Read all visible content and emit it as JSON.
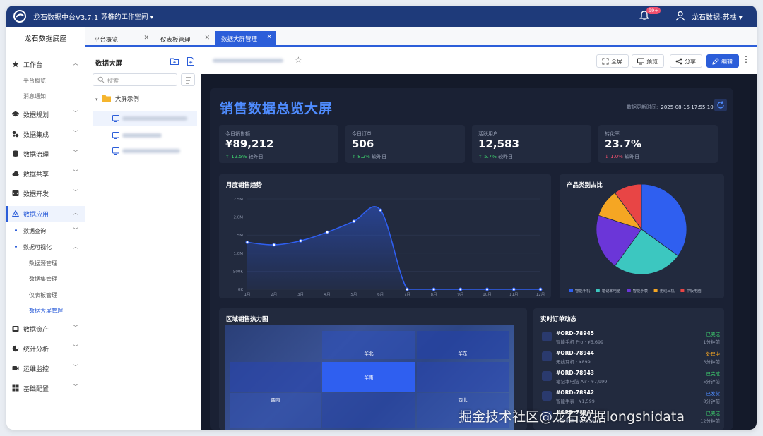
{
  "app": {
    "title": "龙石数据中台V3.7.1",
    "workspace": "苏樵的工作空间",
    "notification_badge": "99+",
    "user": "龙石数据-苏樵"
  },
  "sidebar": {
    "title": "龙石数据底座",
    "items": [
      {
        "label": "工作台",
        "icon": "star-icon"
      },
      {
        "label": "数据规划",
        "icon": "layers-icon"
      },
      {
        "label": "数据集成",
        "icon": "integration-icon"
      },
      {
        "label": "数据治理",
        "icon": "database-icon"
      },
      {
        "label": "数据共享",
        "icon": "cloud-icon"
      },
      {
        "label": "数据开发",
        "icon": "code-icon"
      },
      {
        "label": "数据应用",
        "icon": "app-icon"
      },
      {
        "label": "数据资产",
        "icon": "asset-icon"
      },
      {
        "label": "统计分析",
        "icon": "pie-icon"
      },
      {
        "label": "运维监控",
        "icon": "monitor-icon"
      },
      {
        "label": "基础配置",
        "icon": "grid-icon"
      }
    ],
    "workbench_sub": [
      "平台概览",
      "消息通知"
    ],
    "app_sub": [
      "数据查询",
      "数据可视化"
    ],
    "visual_sub": [
      "数据源管理",
      "数据集管理",
      "仪表板管理",
      "数据大屏管理"
    ]
  },
  "tabs": [
    {
      "label": "平台概览"
    },
    {
      "label": "仪表板管理"
    },
    {
      "label": "数据大屏管理"
    }
  ],
  "tree": {
    "title": "数据大屏",
    "search_placeholder": "搜索",
    "folder": "大屏示例"
  },
  "toolbar": {
    "fullscreen": "全屏",
    "preview": "预览",
    "share": "分享",
    "edit": "编辑"
  },
  "dashboard": {
    "title": "销售数据总览大屏",
    "updated_label": "数据更新时间:",
    "updated_value": "2025-08-15 17:55:10",
    "kpis": [
      {
        "label": "今日销售额",
        "value": "¥89,212",
        "delta": "12.5%",
        "dir": "up",
        "compare": "较昨日"
      },
      {
        "label": "今日订单",
        "value": "506",
        "delta": "8.2%",
        "dir": "up",
        "compare": "较昨日"
      },
      {
        "label": "活跃用户",
        "value": "12,583",
        "delta": "5.7%",
        "dir": "up",
        "compare": "较昨日"
      },
      {
        "label": "转化率",
        "value": "23.7%",
        "delta": "1.0%",
        "dir": "down",
        "compare": "较昨日"
      }
    ],
    "line_title": "月度销售趋势",
    "pie_title": "产品类别占比",
    "heat_title": "区域销售热力图",
    "heat_regions": [
      "华北",
      "华东",
      "华南",
      "西南",
      "西北"
    ],
    "orders_title": "实时订单动态",
    "orders": [
      {
        "id": "#ORD-78945",
        "product": "智能手机 Pro · ¥5,699",
        "status": "已完成",
        "status_color": "#3ecf6e",
        "time": "1分钟前"
      },
      {
        "id": "#ORD-78944",
        "product": "无线耳机 · ¥899",
        "status": "处理中",
        "status_color": "#f5a623",
        "time": "3分钟前"
      },
      {
        "id": "#ORD-78943",
        "product": "笔记本电脑 Air · ¥7,999",
        "status": "已完成",
        "status_color": "#3ecf6e",
        "time": "5分钟前"
      },
      {
        "id": "#ORD-78942",
        "product": "智能手表 · ¥1,599",
        "status": "已发货",
        "status_color": "#4f8cff",
        "time": "8分钟前"
      },
      {
        "id": "#ORD-78941",
        "product": "平板电脑 · ¥3,799",
        "status": "已完成",
        "status_color": "#3ecf6e",
        "time": "12分钟前"
      }
    ]
  },
  "chart_data": [
    {
      "type": "area",
      "title": "月度销售趋势",
      "categories": [
        "1月",
        "2月",
        "3月",
        "4月",
        "5月",
        "6月",
        "7月",
        "8月",
        "9月",
        "10月",
        "11月",
        "12月"
      ],
      "values": [
        1300000,
        1230000,
        1340000,
        1580000,
        1880000,
        2190000,
        0,
        0,
        0,
        0,
        0,
        0
      ],
      "yticks": [
        "0K",
        "500K",
        "1.0M",
        "1.5M",
        "2.0M",
        "2.5M"
      ],
      "ylim": [
        0,
        2500000
      ],
      "color": "#2f5ff0"
    },
    {
      "type": "pie",
      "title": "产品类别占比",
      "categories": [
        "智能手机",
        "笔记本电脑",
        "智能手表",
        "无线耳机",
        "平板电脑"
      ],
      "values": [
        35,
        25,
        20,
        10,
        10
      ],
      "colors": [
        "#2f5ff0",
        "#3cc7c0",
        "#6b36d8",
        "#f5a623",
        "#e84545"
      ]
    }
  ],
  "watermark": "掘金技术社区@龙石数据longshidata"
}
